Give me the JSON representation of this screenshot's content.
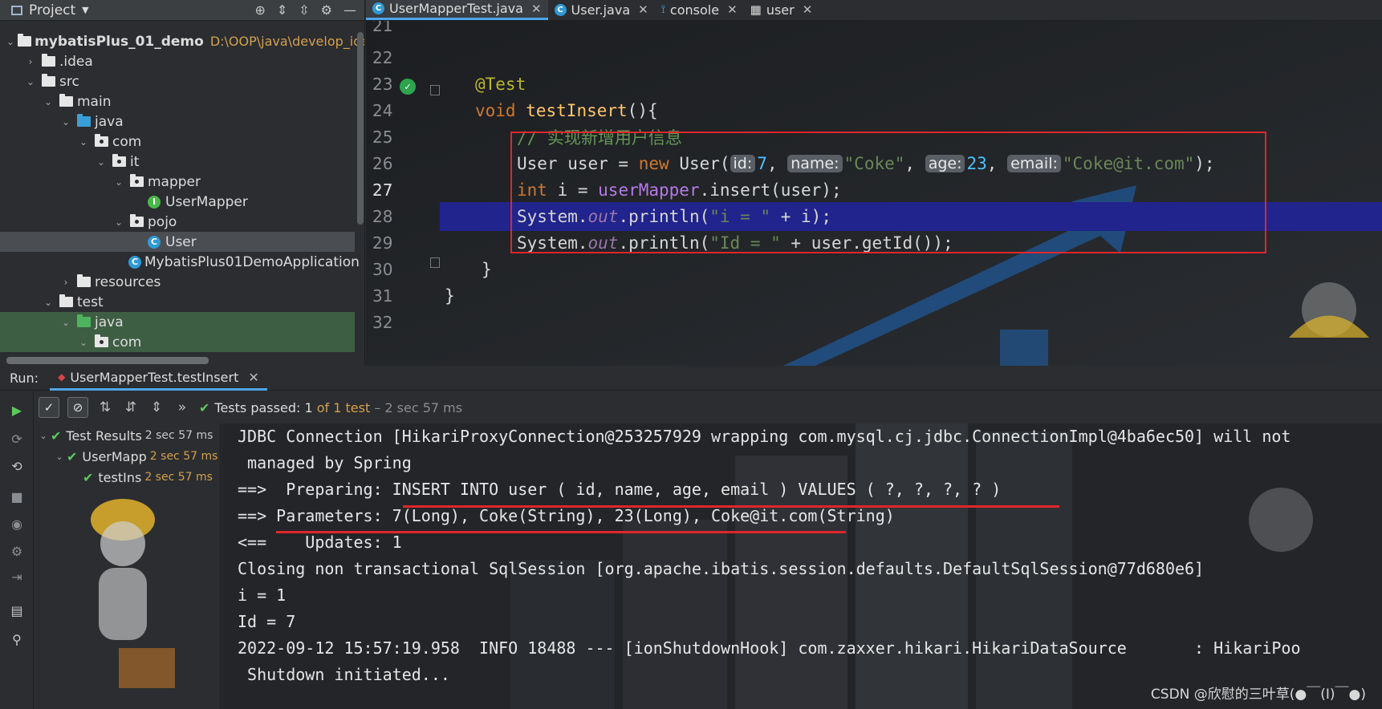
{
  "project": {
    "title": "Project",
    "tree": [
      {
        "label": "mybatisPlus_01_demo",
        "hint": "D:\\OOP\\java\\develop_ide"
      },
      {
        "label": ".idea"
      },
      {
        "label": "src"
      },
      {
        "label": "main"
      },
      {
        "label": "java"
      },
      {
        "label": "com"
      },
      {
        "label": "it"
      },
      {
        "label": "mapper"
      },
      {
        "label": "UserMapper"
      },
      {
        "label": "pojo"
      },
      {
        "label": "User"
      },
      {
        "label": "MybatisPlus01DemoApplication"
      },
      {
        "label": "resources"
      },
      {
        "label": "test"
      },
      {
        "label": "java"
      },
      {
        "label": "com"
      }
    ]
  },
  "tabs": [
    {
      "label": "UserMapperTest.java"
    },
    {
      "label": "User.java"
    },
    {
      "label": "console"
    },
    {
      "label": "user"
    }
  ],
  "editor": {
    "line_numbers": [
      "21",
      "22",
      "23",
      "24",
      "25",
      "26",
      "27",
      "28",
      "29",
      "30",
      "31",
      "32"
    ],
    "annotation": "@Test",
    "kw_void": "void",
    "method": "testInsert",
    "paren_open": "(){",
    "comment": "// 实现新增用户信息",
    "l25": {
      "type": "User",
      "var": " user = ",
      "kw_new": "new",
      "ctor": " User(",
      "h_id": "id:",
      "v_id": "7",
      "c1": ", ",
      "h_name": "name:",
      "v_name": "\"Coke\"",
      "c2": ", ",
      "h_age": "age:",
      "v_age": "23",
      "c3": ", ",
      "h_email": "email:",
      "v_email": "\"Coke@it.com\"",
      "end": ");"
    },
    "l26": {
      "kw_int": "int",
      "mid": " i = ",
      "field": "userMapper",
      "rest": ".insert(user);"
    },
    "l27": {
      "a": "System.",
      "out": "out",
      "b": ".println(",
      "s": "\"i = \"",
      "c": " + i);"
    },
    "l28": {
      "a": "System.",
      "out": "out",
      "b": ".println(",
      "s": "\"Id = \"",
      "c": " + user.getId());"
    },
    "close_method": "}",
    "close_class": "}"
  },
  "run": {
    "label": "Run:",
    "tab": "UserMapperTest.testInsert",
    "passed_prefix": "Tests passed: ",
    "passed_count": "1",
    "passed_of": " of 1 test",
    "passed_time": " – 2 sec 57 ms"
  },
  "results": [
    {
      "label": "Test Results",
      "time": "2 sec 57 ms"
    },
    {
      "label": "UserMapp",
      "time": "2 sec 57 ms"
    },
    {
      "label": "testIns",
      "time": "2 sec 57 ms"
    }
  ],
  "console": [
    "JDBC Connection [HikariProxyConnection@253257929 wrapping com.mysql.cj.jdbc.ConnectionImpl@4ba6ec50] will not",
    " managed by Spring",
    "==>  Preparing: INSERT INTO user ( id, name, age, email ) VALUES ( ?, ?, ?, ? )",
    "==> Parameters: 7(Long), Coke(String), 23(Long), Coke@it.com(String)",
    "<==    Updates: 1",
    "Closing non transactional SqlSession [org.apache.ibatis.session.defaults.DefaultSqlSession@77d680e6]",
    "i = 1",
    "Id = 7",
    "2022-09-12 15:57:19.958  INFO 18488 --- [ionShutdownHook] com.zaxxer.hikari.HikariDataSource       : HikariPoo",
    " Shutdown initiated..."
  ],
  "watermark": "CSDN @欣慰的三叶草(●￣(I)￣●)",
  "colors": {
    "highlight": "#21248c",
    "redbox": "#e0262b",
    "pass": "#5cc85c"
  }
}
